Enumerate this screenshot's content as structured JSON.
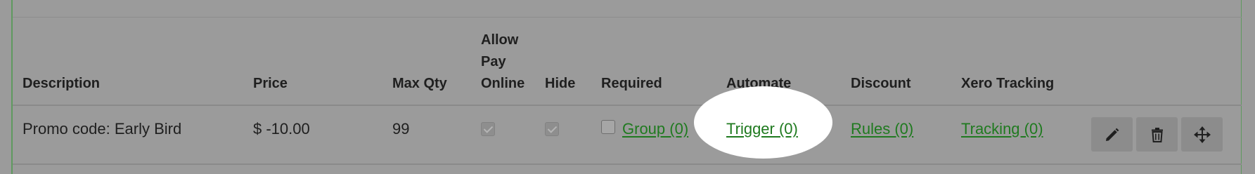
{
  "table": {
    "headers": {
      "description": "Description",
      "price": "Price",
      "max_qty": "Max Qty",
      "allow_pay_online": [
        "Allow",
        "Pay",
        "Online"
      ],
      "hide": "Hide",
      "required": "Required",
      "automate": "Automate",
      "discount": "Discount",
      "xero_tracking": "Xero Tracking"
    },
    "row": {
      "description": "Promo code: Early Bird",
      "price": "$ -10.00",
      "max_qty": "99",
      "allow_pay_online_checked": true,
      "hide_checked": true,
      "required_checked": false,
      "group_link": "Group (0)",
      "trigger_link": "Trigger (0)",
      "rules_link": "Rules (0)",
      "tracking_link": "Tracking (0)"
    },
    "actions": {
      "edit_icon": "pencil-icon",
      "delete_icon": "trash-icon",
      "move_icon": "move-arrows-icon"
    }
  },
  "colors": {
    "background": "#9b9b9b",
    "link": "#1f7a1f",
    "frame_border": "#5f9a5f",
    "spotlight": "#ffffff",
    "action_button": "#8c8c8c"
  }
}
